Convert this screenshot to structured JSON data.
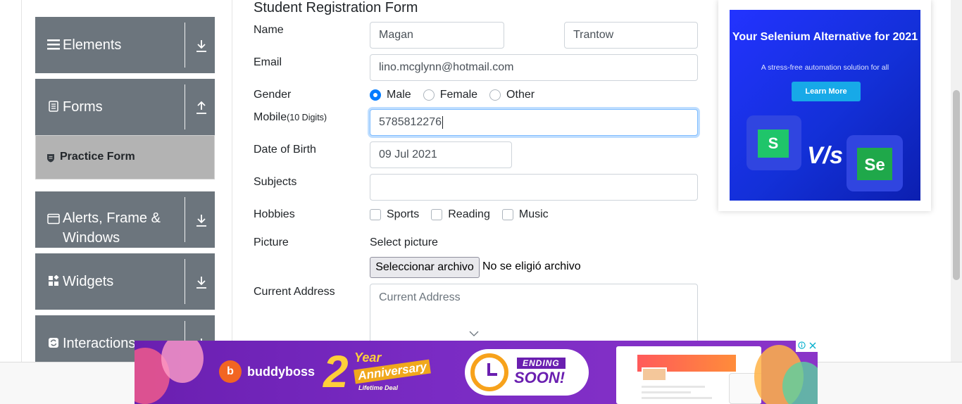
{
  "sidebar": {
    "groups": [
      {
        "label": "Elements",
        "icon": "hamburger-icon",
        "arrow": "download-arrow-icon"
      },
      {
        "label": "Forms",
        "icon": "form-icon",
        "arrow": "upload-arrow-icon"
      },
      {
        "label": "Alerts, Frame & Windows",
        "icon": "window-icon",
        "arrow": "download-arrow-icon"
      },
      {
        "label": "Widgets",
        "icon": "widgets-icon",
        "arrow": "download-arrow-icon"
      },
      {
        "label": "Interactions",
        "icon": "interactions-icon",
        "arrow": "download-arrow-icon"
      }
    ],
    "active_item": {
      "label": "Practice Form",
      "icon": "shield-icon"
    }
  },
  "form": {
    "title": "Student Registration Form",
    "name_label": "Name",
    "first_name": "Magan",
    "last_name": "Trantow",
    "email_label": "Email",
    "email": "lino.mcglynn@hotmail.com",
    "gender_label": "Gender",
    "gender_options": [
      "Male",
      "Female",
      "Other"
    ],
    "gender_selected": "Male",
    "mobile_label": "Mobile",
    "mobile_hint": "(10 Digits)",
    "mobile": "5785812276",
    "dob_label": "Date of Birth",
    "dob": "09 Jul 2021",
    "subjects_label": "Subjects",
    "subjects_value": "",
    "hobbies_label": "Hobbies",
    "hobbies": [
      "Sports",
      "Reading",
      "Music"
    ],
    "picture_label": "Picture",
    "select_picture": "Select picture",
    "file_button": "Seleccionar archivo",
    "file_status": "No se eligió archivo",
    "address_label": "Current Address",
    "address_placeholder": "Current Address"
  },
  "right_ad": {
    "title": "Your Selenium Alternative for 2021",
    "subtitle": "A stress-free automation solution for all",
    "button": "Learn More",
    "vs_text": "V/s",
    "badge_left": "S",
    "badge_right": "Se"
  },
  "bottom_ad": {
    "brand": "buddyboss",
    "brand_mark": "b",
    "big_number": "2",
    "year_text": "Year",
    "anniversary_text": "Anniversary",
    "deal_text": "Lifetime Deal",
    "ending_line1": "ENDING",
    "ending_line2": "SOON!",
    "info_icon": "info-icon",
    "close_icon": "close-icon"
  },
  "colors": {
    "sidebar_bg": "#6c757d",
    "active_item_bg": "#b3b3b3",
    "focus_border": "#80bdff",
    "radio_checked": "#007bff",
    "ad_blue": "#2333ff",
    "bottom_ad_purple": "#6a1fb0"
  }
}
